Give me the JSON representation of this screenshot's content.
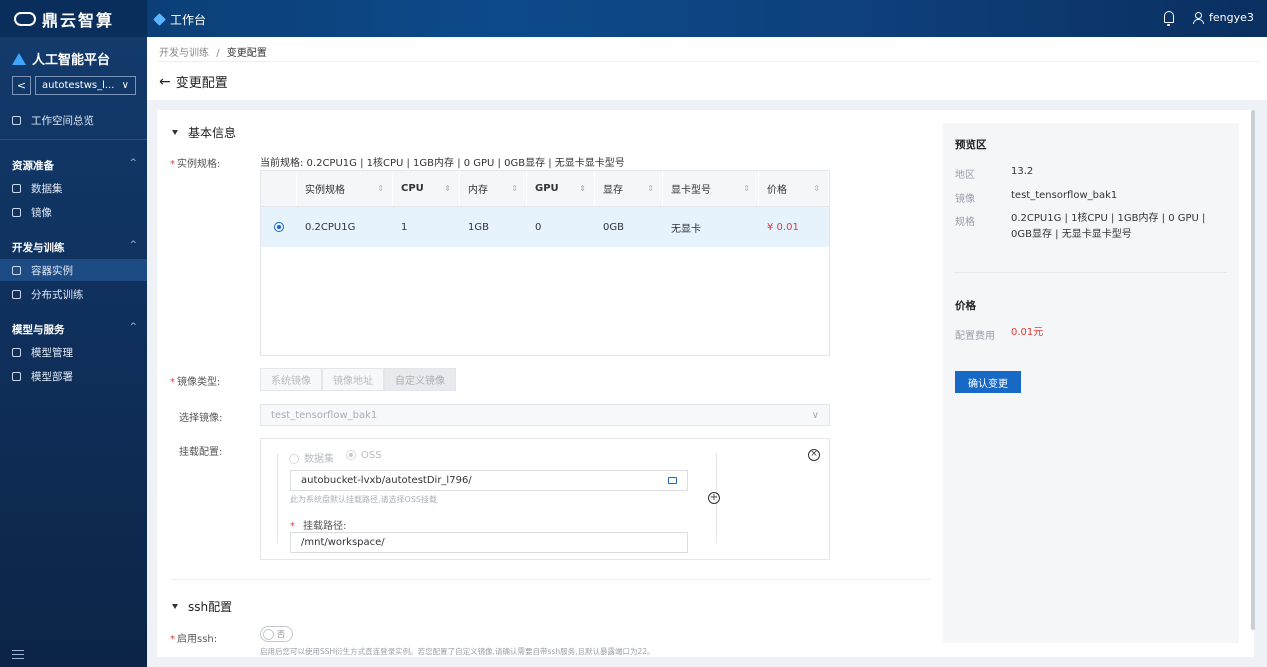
{
  "topbar": {
    "brand": "鼎云智算",
    "workbench": "工作台",
    "user": "fengye3"
  },
  "sidebar": {
    "platform": "人工智能平台",
    "back": "<",
    "workspace": "autotestws_l...",
    "overview": "工作空间总览",
    "groups": [
      {
        "title": "资源准备",
        "items": [
          "数据集",
          "镜像"
        ]
      },
      {
        "title": "开发与训练",
        "items": [
          "容器实例",
          "分布式训练"
        ]
      },
      {
        "title": "模型与服务",
        "items": [
          "模型管理",
          "模型部署"
        ]
      }
    ],
    "active_item": "容器实例"
  },
  "header": {
    "breadcrumb_parent": "开发与训练",
    "breadcrumb_sep": "/",
    "breadcrumb_current": "变更配置",
    "title": "变更配置"
  },
  "basic": {
    "section_title": "基本信息",
    "spec_label": "实例规格:",
    "current_spec": "当前规格: 0.2CPU1G | 1核CPU | 1GB内存 | 0 GPU  |  0GB显存 | 无显卡显卡型号",
    "table": {
      "columns": [
        "实例规格",
        "CPU",
        "内存",
        "GPU",
        "显存",
        "显卡型号",
        "价格"
      ],
      "rows": [
        {
          "spec": "0.2CPU1G",
          "cpu": "1",
          "mem": "1GB",
          "gpu": "0",
          "vram": "0GB",
          "card": "无显卡",
          "price": "¥ 0.01"
        }
      ]
    },
    "image_type_label": "镜像类型:",
    "image_types": [
      "系统镜像",
      "镜像地址",
      "自定义镜像"
    ],
    "select_image_label": "选择镜像:",
    "select_image_value": "test_tensorflow_bak1",
    "mount_label": "挂载配置:",
    "mount_options": [
      "数据集",
      "OSS"
    ],
    "oss_path": "autobucket-lvxb/autotestDir_l796/",
    "oss_hint": "此为系统盘默认挂载路径,请选择OSS挂载",
    "mount_path_label": "挂载路径:",
    "mount_path_value": "/mnt/workspace/"
  },
  "ssh": {
    "section_title": "ssh配置",
    "enable_label": "启用ssh:",
    "toggle_text": "否",
    "hint": "启用后您可以使用SSH衍生方式直连登录实例。若您配置了自定义镜像,请确认需要自带ssh服务,且默认暴露端口为22。"
  },
  "preview": {
    "title": "预览区",
    "region_label": "地区",
    "region_value": "13.2",
    "image_label": "镜像",
    "image_value": "test_tensorflow_bak1",
    "spec_label": "规格",
    "spec_value": "0.2CPU1G | 1核CPU | 1GB内存 | 0 GPU  |  0GB显存 | 无显卡显卡型号",
    "price_title": "价格",
    "fee_label": "配置费用",
    "fee_value": "0.01元",
    "confirm": "确认变更"
  },
  "colors": {
    "primary": "#1769c6",
    "price": "#e23b3b",
    "sidebar": "#0f2f5a"
  }
}
